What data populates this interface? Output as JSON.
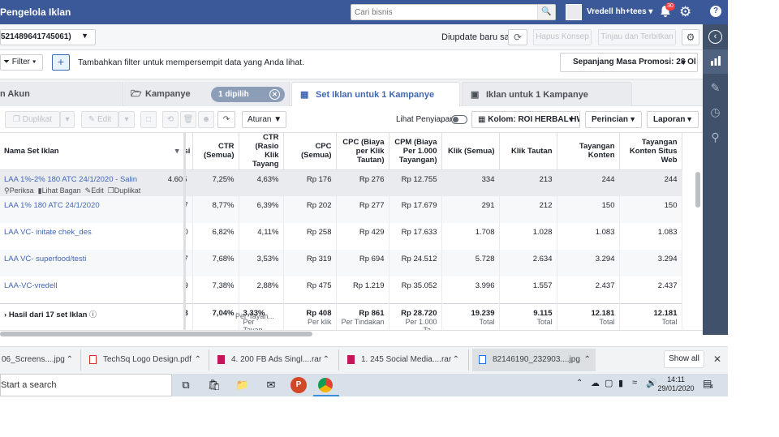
{
  "topbar": {
    "title": "Pengelola Iklan",
    "search_placeholder": "Cari bisnis",
    "account_name": "Vredell hh+tees",
    "notifications": "30"
  },
  "account_row": {
    "account_id": "521489641745061)",
    "updated": "Diupdate baru saja",
    "discard": "Hapus Konsep",
    "review": "Tinjau dan Terbitkan"
  },
  "filter": {
    "label": "Filter",
    "hint": "Tambahkan filter untuk mempersempit data yang Anda lihat.",
    "date_range": "Sepanjang Masa Promosi: 28 Ol"
  },
  "tabs": {
    "account": "n Akun",
    "campaign": "Kampanye",
    "selected": "1 dipilih",
    "adset": "Set Iklan untuk 1 Kampanye",
    "ads": "Iklan untuk 1 Kampanye"
  },
  "toolbar": {
    "duplicate": "Duplikat",
    "edit": "Edit",
    "rules": "Aturan",
    "preview": "Lihat Penyiapan",
    "columns": "Kolom: ROI HERBAL HWI",
    "breakdown": "Perincian",
    "reports": "Laporan"
  },
  "table": {
    "headers": [
      "Nama Set Iklan",
      "si",
      "CTR (Semua)",
      "CTR (Rasio Klik Tayang",
      "CPC (Semua)",
      "CPC (Biaya per Klik Tautan)",
      "CPM (Biaya Per 1.000 Tayangan)",
      "Klik (Semua)",
      "Klik Tautan",
      "Tayangan Konten",
      "Tayangan Konten Situs Web"
    ],
    "row_actions": {
      "inspect": "Periksa",
      "chart": "Lihat Bagan",
      "edit": "Edit",
      "duplicate": "Duplikat"
    },
    "rows": [
      [
        "LAA 1%-2% 180 ATC 24/1/2020 - Salin",
        "4.605",
        "7,25%",
        "4,63%",
        "Rp 176",
        "Rp 276",
        "Rp 12.755",
        "334",
        "213",
        "244",
        "244"
      ],
      [
        "LAA 1% 180 ATC 24/1/2020",
        "7",
        "8,77%",
        "6,39%",
        "Rp 202",
        "Rp 277",
        "Rp 17.679",
        "291",
        "212",
        "150",
        "150"
      ],
      [
        "LAA VC- initate chek_des",
        "0",
        "6,82%",
        "4,11%",
        "Rp 258",
        "Rp 429",
        "Rp 17.633",
        "1.708",
        "1.028",
        "1.083",
        "1.083"
      ],
      [
        "LAA VC- superfood/testi",
        "7",
        "7,68%",
        "3,53%",
        "Rp 319",
        "Rp 694",
        "Rp 24.512",
        "5.728",
        "2.634",
        "3.294",
        "3.294"
      ],
      [
        "LAA-VC-vredell",
        "9",
        "7,38%",
        "2,88%",
        "Rp 475",
        "Rp 1.219",
        "Rp 35.052",
        "3.996",
        "1.557",
        "2.437",
        "2.437"
      ]
    ],
    "totals": {
      "label": "Hasil dari 17 set Iklan",
      "values": [
        "3",
        "7,04%",
        "3,33%",
        "Rp 408",
        "Rp 861",
        "Rp 28.720",
        "19.239",
        "9.115",
        "12.181",
        "12.181"
      ],
      "subs": [
        "",
        "",
        "Per Tayan...",
        "Per Tayan...",
        "Per klik",
        "Per Tindakan",
        "Per 1.000 Ta...",
        "Total",
        "Total",
        "Total",
        "Total"
      ]
    }
  },
  "downloads": {
    "items": [
      "06_Screens....jpg",
      "TechSq Logo Design.pdf",
      "4. 200 FB Ads Singl....rar",
      "1. 245 Social Media....rar",
      "82146190_232903....jpg"
    ],
    "show_all": "Show all"
  },
  "taskbar": {
    "search": "Start a search",
    "time": "14:11",
    "date": "29/01/2020",
    "notif": "4"
  },
  "colors": {
    "brand": "#3b5998",
    "link": "#4267b2",
    "sidebar": "#40516b"
  }
}
